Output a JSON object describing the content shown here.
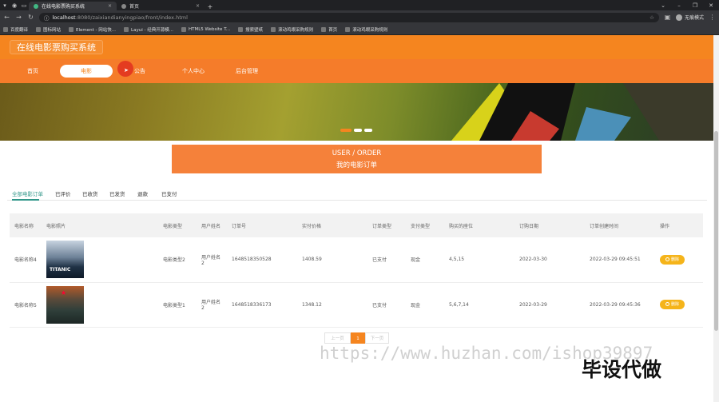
{
  "browser": {
    "tabs": [
      {
        "title": "在线电影票购买系统",
        "active": true
      },
      {
        "title": "首页",
        "active": false
      }
    ],
    "new_tab": "+",
    "address": {
      "host": "localhost",
      "path": ":8080/zaixiandianyingpiao/front/index.html"
    },
    "profile": "无痕模式",
    "bookmarks": [
      "百度翻译",
      "图标网站",
      "Element - 网站快...",
      "Layui - 经典开源模...",
      "HTML5 Website T...",
      "搜索壁纸",
      "滚动鸡眼采购规则",
      "首页",
      "滚动鸡眼采购规则"
    ]
  },
  "header": {
    "brand": "在线电影票购买系统"
  },
  "nav": {
    "items": [
      "首页",
      "电影",
      "公告",
      "个人中心",
      "后台管理"
    ],
    "active_index": 1
  },
  "banner": {
    "slides": 3,
    "active_index": 0
  },
  "section_title": {
    "en": "USER / ORDER",
    "cn": "我的电影订单"
  },
  "order_tabs": {
    "items": [
      "全部电影订单",
      "已评价",
      "已收货",
      "已发货",
      "退款",
      "已支付"
    ],
    "active_index": 0
  },
  "table": {
    "headers": [
      "电影名称",
      "电影照片",
      "电影类型",
      "用户姓名",
      "订单号",
      "实付价格",
      "订单类型",
      "支付类型",
      "购买的座位",
      "订购日期",
      "订单创建时间",
      "操作"
    ],
    "rows": [
      {
        "name": "电影名称4",
        "poster": "titanic-poster",
        "type": "电影类型2",
        "user": "用户姓名2",
        "order_no": "1648518350528",
        "price": "1408.59",
        "order_type": "已支付",
        "pay_type": "现金",
        "seats": "4,5,15",
        "date": "2022-03-30",
        "created": "2022-03-29 09:45:51",
        "action": "删除"
      },
      {
        "name": "电影名称5",
        "poster": "war-poster",
        "type": "电影类型1",
        "user": "用户姓名2",
        "order_no": "1648518336173",
        "price": "1348.12",
        "order_type": "已支付",
        "pay_type": "现金",
        "seats": "5,6,7,14",
        "date": "2022-03-29",
        "created": "2022-03-29 09:45:36",
        "action": "删除"
      }
    ]
  },
  "pager": {
    "prev": "上一页",
    "current": "1",
    "next": "下一页"
  },
  "watermark": {
    "url": "https://www.huzhan.com/ishop39897",
    "brand": "毕设代做"
  },
  "colors": {
    "accent": "#f5851f",
    "nav": "#f57c2a",
    "tab_active": "#2f9688",
    "delete": "#f5b41a"
  }
}
